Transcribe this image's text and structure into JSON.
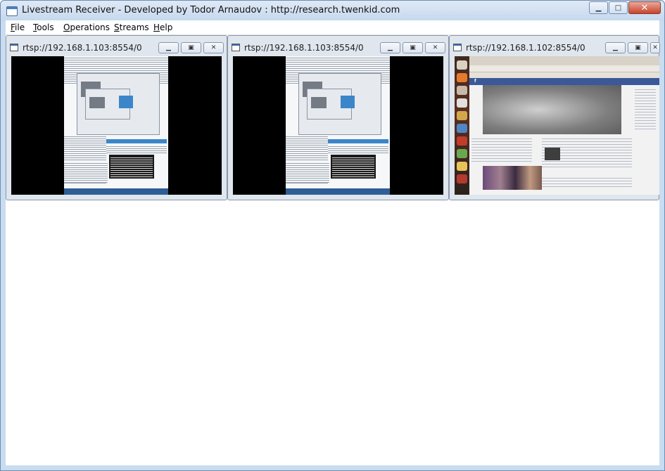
{
  "window": {
    "title": "Livestream Receiver - Developed by Todor Arnaudov : http://research.twenkid.com",
    "minimize_glyph": "▁",
    "maximize_glyph": "□",
    "close_glyph": "✕"
  },
  "menu": {
    "items": [
      {
        "label": "File"
      },
      {
        "label": "Tools"
      },
      {
        "label": "Operations"
      },
      {
        "label": "Streams"
      },
      {
        "label": "Help"
      }
    ]
  },
  "streams": [
    {
      "url": "rtsp://192.168.1.103:8554/0",
      "content": "remote Windows desktop feed"
    },
    {
      "url": "rtsp://192.168.1.103:8554/0",
      "content": "remote Windows desktop feed"
    },
    {
      "url": "rtsp://192.168.1.102:8554/0",
      "content": "Ubuntu desktop with Facebook page in browser"
    }
  ],
  "subwindow_buttons": {
    "minimize_glyph": "▁",
    "restore_glyph": "▣",
    "close_glyph": "✕"
  },
  "icons": [
    "app-window-icon",
    "stream-window-icon",
    "minimize-icon",
    "maximize-icon",
    "close-icon",
    "restore-icon"
  ],
  "colors": {
    "title_bar": "#c6d8ee",
    "close_button": "#c7432a",
    "video_background": "#000000",
    "facebook_bar": "#3b5998"
  }
}
